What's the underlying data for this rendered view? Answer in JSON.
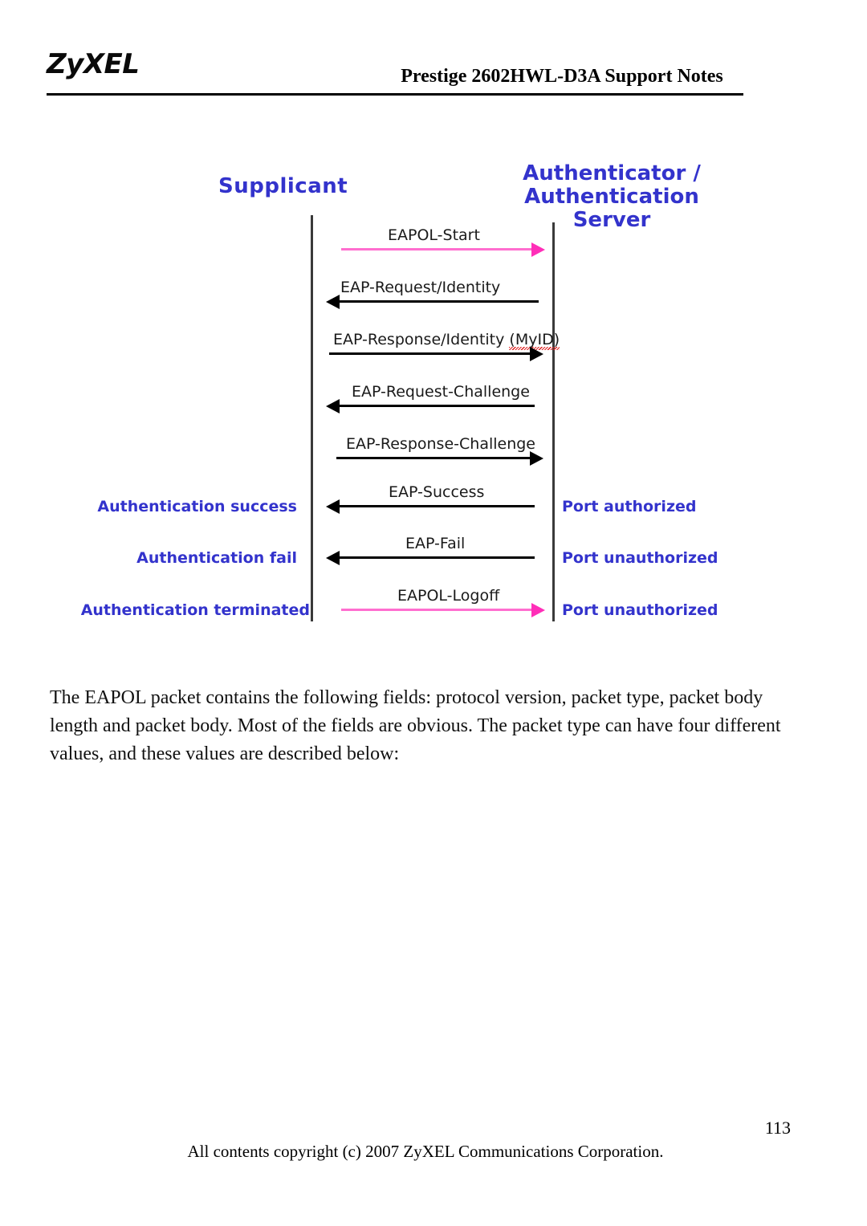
{
  "document": {
    "header": {
      "logo_text": "ZyXEL",
      "title": "Prestige 2602HWL-D3A Support Notes"
    },
    "footer": {
      "page_number": "113",
      "copyright": "All contents copyright (c) 2007 ZyXEL Communications Corporation."
    }
  },
  "colors": {
    "role_blue": "#3333CC",
    "label_blue": "#3333CC",
    "eapol_pink": "#FF6ECF",
    "arrow_black": "#000000",
    "squiggle_red": "#E02020"
  },
  "diagram": {
    "type": "sequence",
    "roles": {
      "left": "Supplicant",
      "right_line1": "Authenticator /",
      "right_line2": "Authentication Server"
    },
    "messages": [
      {
        "label": "EAPOL-Start",
        "direction": "right",
        "color": "pink",
        "left_state": "",
        "right_state": ""
      },
      {
        "label": "EAP-Request/Identity",
        "direction": "left",
        "color": "black",
        "left_state": "",
        "right_state": ""
      },
      {
        "label": "EAP-Response/Identity (MyID)",
        "label_plain": "EAP-Response/Identity ",
        "label_marked": "(MyID)",
        "direction": "right",
        "color": "black",
        "spellcheck_underline": true,
        "left_state": "",
        "right_state": ""
      },
      {
        "label": "EAP-Request-Challenge",
        "direction": "left",
        "color": "black",
        "left_state": "",
        "right_state": ""
      },
      {
        "label": "EAP-Response-Challenge",
        "direction": "right",
        "color": "black",
        "left_state": "",
        "right_state": ""
      },
      {
        "label": "EAP-Success",
        "direction": "left",
        "color": "black",
        "left_state": "Authentication success",
        "right_state": "Port authorized"
      },
      {
        "label": "EAP-Fail",
        "direction": "left",
        "color": "black",
        "left_state": "Authentication fail",
        "right_state": "Port unauthorized"
      },
      {
        "label": "EAPOL-Logoff",
        "direction": "right",
        "color": "pink",
        "left_state": "Authentication terminated",
        "right_state": "Port unauthorized"
      }
    ]
  },
  "body": {
    "paragraph": "The EAPOL packet contains the following fields: protocol version, packet type, packet body length and packet body. Most of the fields are obvious. The packet type can have four different values, and these values are described below:"
  }
}
